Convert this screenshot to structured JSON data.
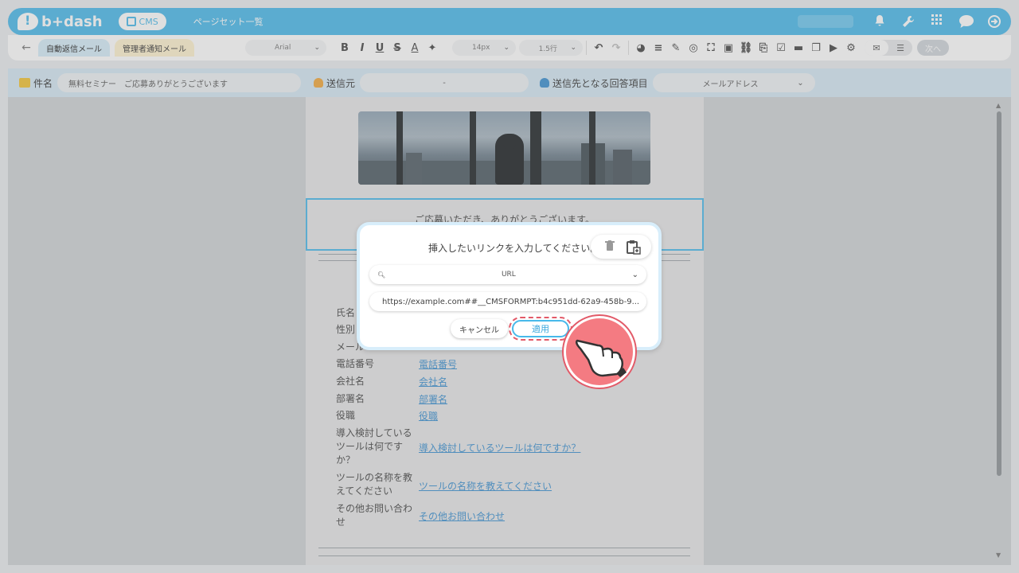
{
  "header": {
    "logo_text": "b+dash",
    "cms_label": "CMS",
    "page_title": "ページセット一覧"
  },
  "toolbar": {
    "tabs": [
      {
        "label": "自動返信メール",
        "active": true
      },
      {
        "label": "管理者通知メール",
        "active": false
      }
    ],
    "font_family": "Arial",
    "font_size": "14px",
    "line_height": "1.5行",
    "send_label": "次へ"
  },
  "meta": {
    "subject_label": "件名",
    "subject_value": "無料セミナー　ご応募ありがとうございます",
    "sender_label": "送信元",
    "sender_value": "-",
    "recipient_label": "送信先となる回答項目",
    "recipient_value": "メールアドレス"
  },
  "body": {
    "thanks_text": "ご応募いただき、ありがとうございます。",
    "form_rows": [
      {
        "label": "氏名",
        "value": ""
      },
      {
        "label": "性別",
        "value": ""
      },
      {
        "label": "メール",
        "value": ""
      },
      {
        "label": "電話番号",
        "value": "電話番号"
      },
      {
        "label": "会社名",
        "value": "会社名"
      },
      {
        "label": "部署名",
        "value": "部署名"
      },
      {
        "label": "役職",
        "value": "役職"
      },
      {
        "label": "導入検討しているツールは何ですか？",
        "value": "導入検討しているツールは何ですか？"
      },
      {
        "label": "ツールの名称を教えてください",
        "value": "ツールの名称を教えてください"
      },
      {
        "label": "その他お問い合わせ",
        "value": "その他お問い合わせ"
      }
    ]
  },
  "dialog": {
    "title": "挿入したいリンクを入力してください。",
    "select_placeholder": "URL",
    "url_value": "https://example.com##__CMSFORMPT:b4c951dd-62a9-458b-9...",
    "cancel_label": "キャンセル",
    "apply_label": "適用"
  },
  "colors": {
    "accent": "#48b9ea",
    "highlight": "#e25a68",
    "hand_bg": "#f47b82"
  }
}
